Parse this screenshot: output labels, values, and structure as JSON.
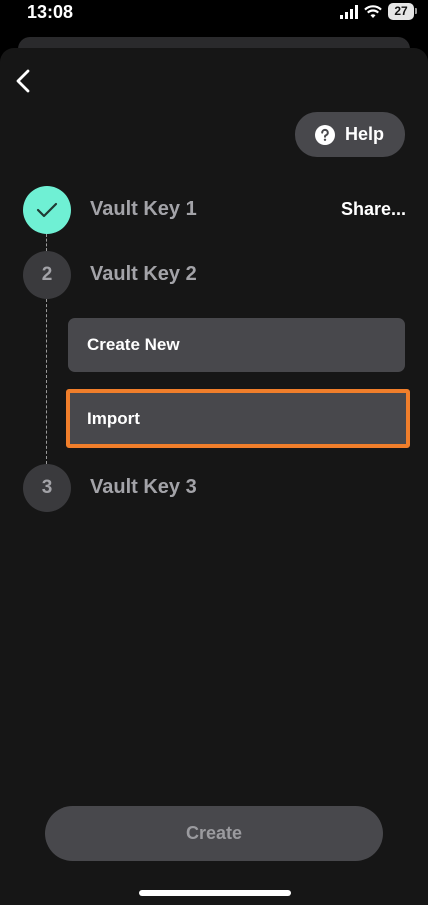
{
  "status_bar": {
    "time": "13:08",
    "battery": "27"
  },
  "header": {
    "help_label": "Help"
  },
  "steps": [
    {
      "number": "1",
      "label": "Vault Key 1",
      "state": "done",
      "action": "Share..."
    },
    {
      "number": "2",
      "label": "Vault Key 2",
      "state": "active"
    },
    {
      "number": "3",
      "label": "Vault Key 3",
      "state": "pending"
    }
  ],
  "options": [
    {
      "label": "Create New"
    },
    {
      "label": "Import",
      "highlighted": true
    }
  ],
  "footer": {
    "create_label": "Create"
  },
  "colors": {
    "accent": "#6ff0d4",
    "highlight": "#f07e2b",
    "surface": "#48484c",
    "background": "#161616"
  }
}
